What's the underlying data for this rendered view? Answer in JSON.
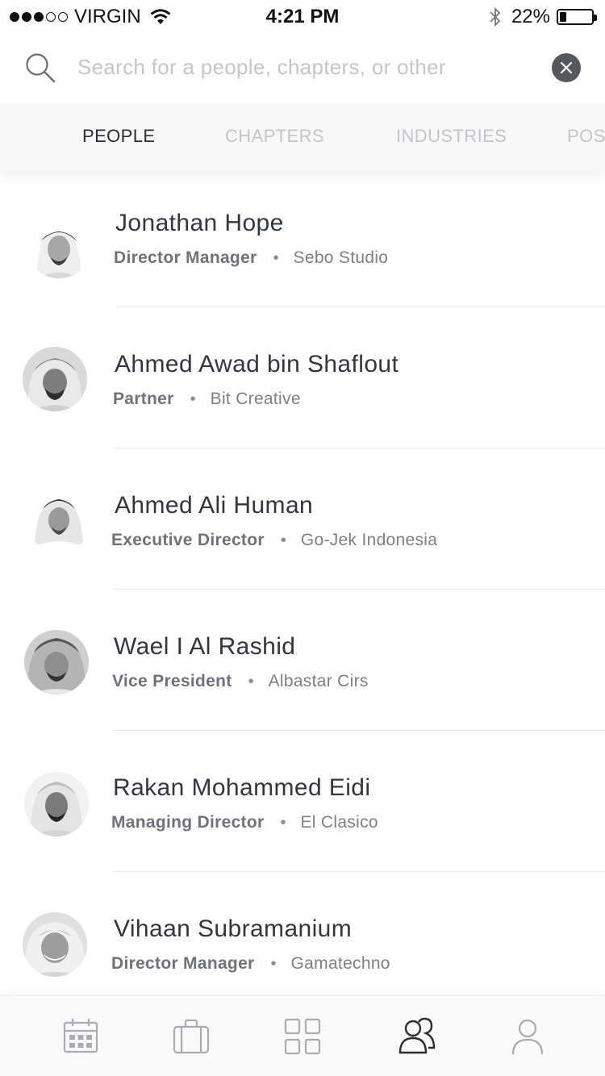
{
  "status_bar": {
    "carrier": "VIRGIN",
    "time": "4:21 PM",
    "battery_percent": "22%",
    "battery_level": 0.22,
    "signal_bars_filled": 3,
    "signal_bars_total": 5
  },
  "search": {
    "placeholder": "Search for a people, chapters, or other",
    "value": ""
  },
  "tabs": [
    {
      "label": "PEOPLE",
      "active": true
    },
    {
      "label": "CHAPTERS",
      "active": false
    },
    {
      "label": "INDUSTRIES",
      "active": false
    },
    {
      "label": "POS",
      "active": false
    }
  ],
  "people": [
    {
      "name": "Jonathan Hope",
      "role": "Director Manager",
      "company": "Sebo Studio"
    },
    {
      "name": "Ahmed Awad bin Shaflout",
      "role": "Partner",
      "company": "Bit Creative"
    },
    {
      "name": "Ahmed Ali Human",
      "role": "Executive Director",
      "company": "Go-Jek Indonesia"
    },
    {
      "name": "Wael I Al Rashid",
      "role": "Vice President",
      "company": "Albastar Cirs"
    },
    {
      "name": "Rakan Mohammed Eidi",
      "role": "Managing Director",
      "company": "El Clasico"
    },
    {
      "name": "Vihaan Subramanium",
      "role": "Director Manager",
      "company": "Gamatechno"
    }
  ],
  "separator": "•",
  "bottom_nav": [
    {
      "icon": "calendar-icon",
      "active": false
    },
    {
      "icon": "briefcase-icon",
      "active": false
    },
    {
      "icon": "grid-icon",
      "active": false
    },
    {
      "icon": "people-icon",
      "active": true
    },
    {
      "icon": "profile-icon",
      "active": false
    }
  ],
  "colors": {
    "text_primary": "#33373d",
    "text_secondary": "#7c8085",
    "tab_inactive": "#c2c5c9",
    "nav_inactive": "#a9adb1",
    "nav_active": "#2a2d31"
  }
}
